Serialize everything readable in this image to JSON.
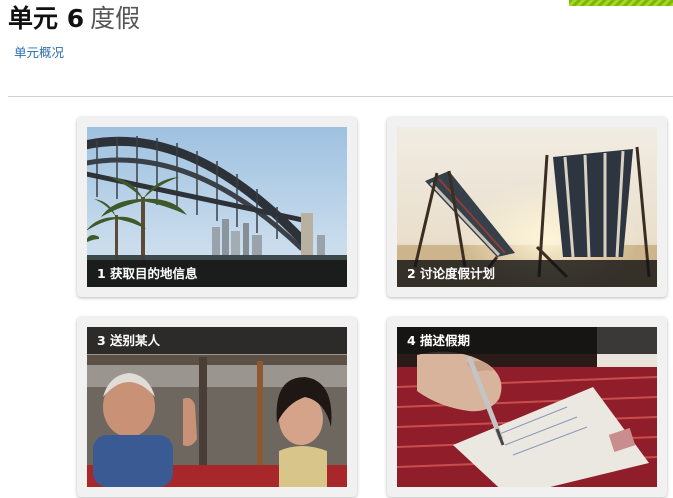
{
  "header": {
    "unit_label": "单元 6",
    "topic": "度假",
    "overview_link": "单元概况"
  },
  "lessons": [
    {
      "caption": "1 获取目的地信息",
      "image": "sydney-harbour-bridge-photo"
    },
    {
      "caption": "2 讨论度假计划",
      "image": "beach-deck-chairs-photo"
    },
    {
      "caption": "3 送别某人",
      "image": "people-on-bus-waving-photo"
    },
    {
      "caption": "4 描述假期",
      "image": "writing-postcard-photo"
    }
  ],
  "colors": {
    "accent": "#7fb800",
    "link": "#2a6fb0",
    "caption_bg": "#141414"
  }
}
